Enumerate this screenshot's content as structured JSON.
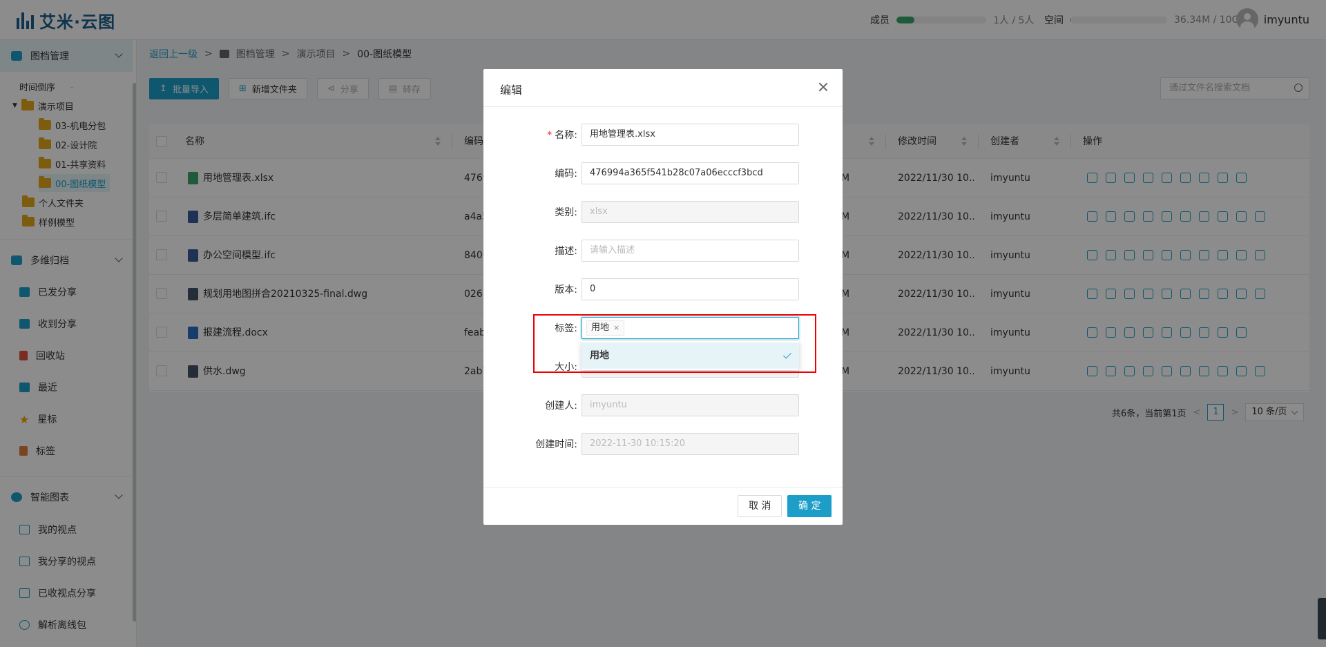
{
  "app": {
    "logo_text": "艾米·云图"
  },
  "header": {
    "members_label": "成员",
    "members_value": "1人 / 5人",
    "members_fraction": 0.2,
    "space_label": "空间",
    "space_value": "36.34M / 10GB",
    "space_fraction": 0.004,
    "username": "imyuntu"
  },
  "sidebar": {
    "section1": "图档管理",
    "sort_label": "时间倒序",
    "tree": {
      "root": "演示项目",
      "children": [
        "03-机电分包",
        "02-设计院",
        "01-共享资料",
        "00-图纸模型"
      ],
      "personal": "个人文件夹",
      "sample": "样例模型"
    },
    "section2": "多维归档",
    "section2_items": [
      "已发分享",
      "收到分享",
      "回收站",
      "最近",
      "星标",
      "标签"
    ],
    "section3": "智能图表",
    "section3_items": [
      "我的视点",
      "我分享的视点",
      "已收视点分享",
      "解析离线包"
    ]
  },
  "breadcrumb": {
    "back": "返回上一级",
    "sep": ">",
    "items": [
      "图档管理",
      "演示项目",
      "00-图纸模型"
    ]
  },
  "toolbar": {
    "import": "批量导入",
    "new_folder": "新增文件夹",
    "share": "分享",
    "transfer": "转存"
  },
  "search": {
    "placeholder": "通过文件名搜索文档"
  },
  "table": {
    "headers": {
      "name": "名称",
      "code": "编码",
      "mtime": "修改时间",
      "creator": "创建者",
      "ops": "操作"
    },
    "rows": [
      {
        "name": "用地管理表.xlsx",
        "code": "4769",
        "size": "M",
        "mtime": "2022/11/30 10...",
        "creator": "imyuntu"
      },
      {
        "name": "多层简单建筑.ifc",
        "code": "a4a5",
        "size": "M",
        "mtime": "2022/11/30 10...",
        "creator": "imyuntu"
      },
      {
        "name": "办公空间模型.ifc",
        "code": "8406",
        "size": "M",
        "mtime": "2022/11/30 10...",
        "creator": "imyuntu"
      },
      {
        "name": "规划用地图拼合20210325-final.dwg",
        "code": "0261",
        "size": "M",
        "mtime": "2022/11/30 10...",
        "creator": "imyuntu"
      },
      {
        "name": "报建流程.docx",
        "code": "feab",
        "size": "M",
        "mtime": "2022/11/30 10...",
        "creator": "imyuntu"
      },
      {
        "name": "供水.dwg",
        "code": "2ab7",
        "size": "M",
        "mtime": "2022/11/30 10...",
        "creator": "imyuntu"
      }
    ]
  },
  "pager": {
    "summary": "共6条，当前第1页",
    "prev": "<",
    "next": ">",
    "page": "1",
    "size": "10 条/页"
  },
  "modal": {
    "title": "编辑",
    "fields": {
      "name_label": "名称:",
      "name_value": "用地管理表.xlsx",
      "code_label": "编码:",
      "code_value": "476994a365f541b28c07a06ecccf3bcd",
      "type_label": "类别:",
      "type_value": "xlsx",
      "desc_label": "描述:",
      "desc_placeholder": "请输入描述",
      "version_label": "版本:",
      "version_value": "0",
      "tags_label": "标签:",
      "tag_value": "用地",
      "tag_remove": "×",
      "size_label": "大小:",
      "creator_label": "创建人:",
      "creator_value": "imyuntu",
      "ctime_label": "创建时间:",
      "ctime_value": "2022-11-30 10:15:20"
    },
    "dropdown_option": "用地",
    "cancel": "取 消",
    "ok": "确 定"
  },
  "colors": {
    "accent": "#1d9ec8",
    "brand": "#1c5f8c",
    "highlight": "#ee0000",
    "folder": "#e6a81b"
  }
}
